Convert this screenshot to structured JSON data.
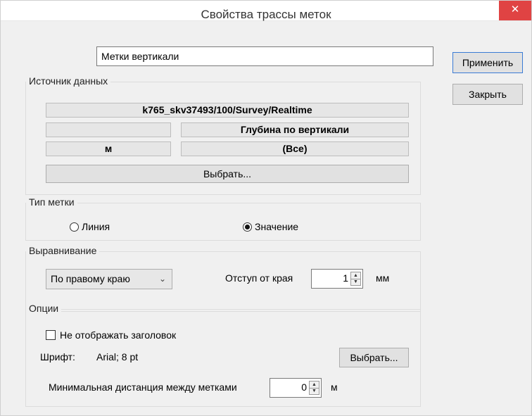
{
  "window": {
    "title": "Свойства трассы меток",
    "close_icon": "✕"
  },
  "name_field": {
    "value": "Метки вертикали"
  },
  "buttons": {
    "apply": "Применить",
    "close": "Закрыть"
  },
  "data_source": {
    "label": "Источник данных",
    "path": "k765_skv37493/100/Survey/Realtime",
    "row2_left": "",
    "row2_right": "Глубина по вертикали",
    "row3_left": "м",
    "row3_right": "(Все)",
    "select_button": "Выбрать..."
  },
  "mark_type": {
    "label": "Тип метки",
    "options": [
      {
        "label": "Линия",
        "selected": false
      },
      {
        "label": "Значение",
        "selected": true
      }
    ]
  },
  "alignment": {
    "label": "Выравнивание",
    "selected": "По правому краю",
    "offset_label": "Отступ от края",
    "offset_value": "1",
    "offset_unit": "мм"
  },
  "options": {
    "label": "Опции",
    "hide_header_label": "Не отображать заголовок",
    "hide_header_checked": false,
    "font_label": "Шрифт:",
    "font_value": "Arial; 8 pt",
    "font_button": "Выбрать...",
    "min_distance_label": "Минимальная дистанция между метками",
    "min_distance_value": "0",
    "min_distance_unit": "м"
  },
  "colors": {
    "close_button": "#e04343",
    "window_bg": "#f0f0f0",
    "primary_border": "#3a7bd5"
  }
}
